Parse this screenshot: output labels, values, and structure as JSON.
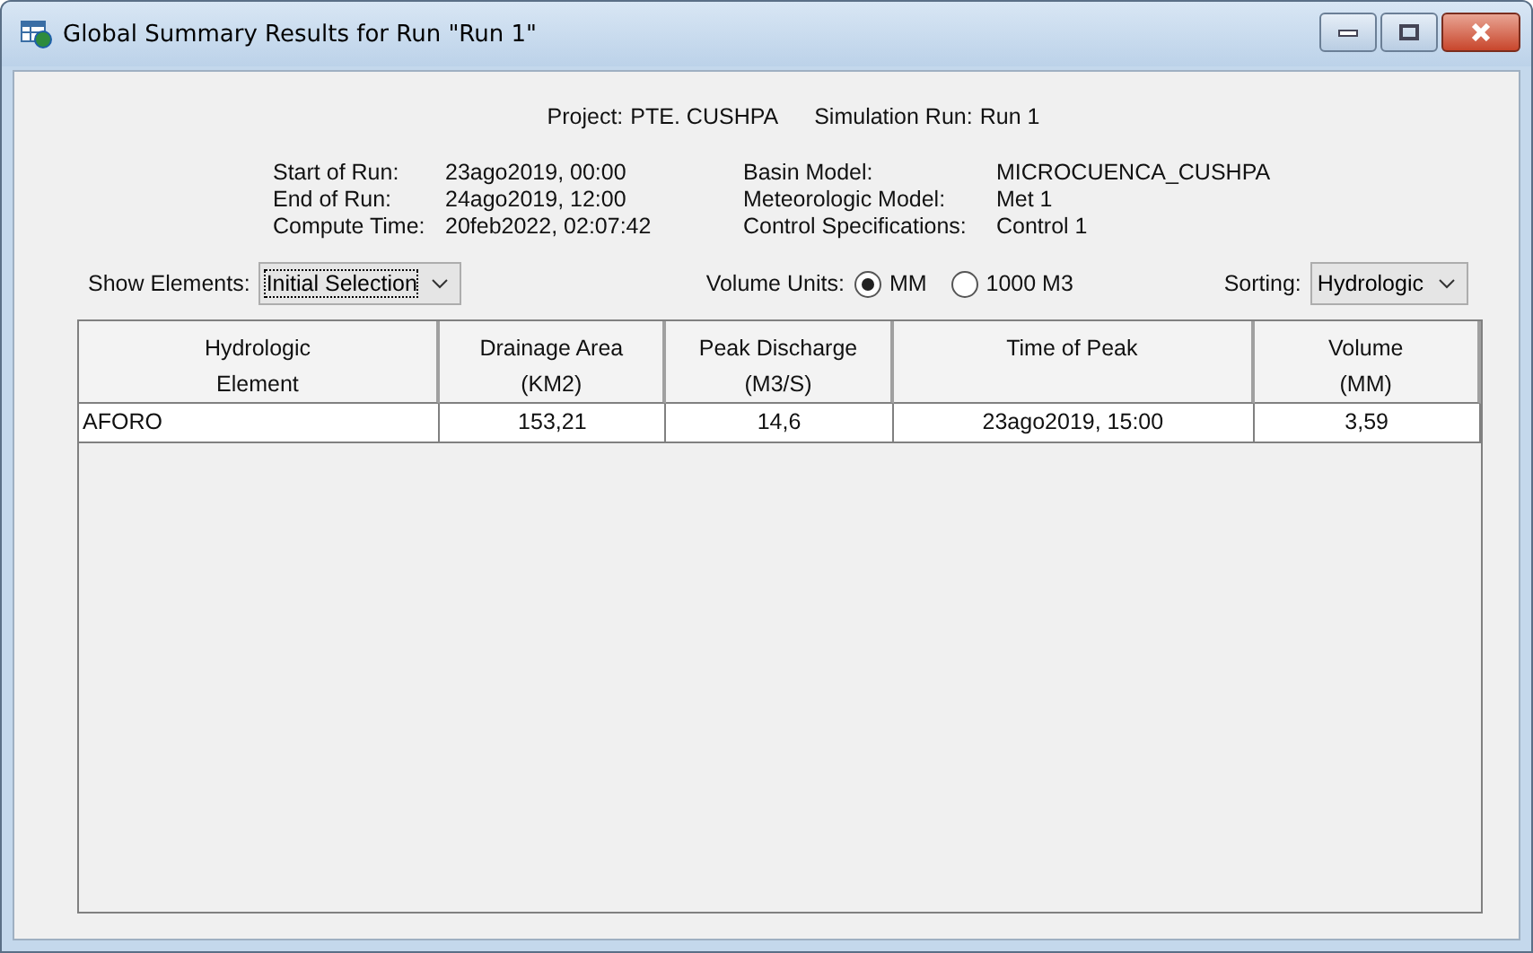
{
  "window": {
    "title": "Global Summary Results for Run \"Run 1\""
  },
  "header": [
    {
      "label": "Project:",
      "value": "PTE. CUSHPA"
    },
    {
      "label": "Simulation Run:",
      "value": "Run 1"
    }
  ],
  "run_info": [
    {
      "label": "Start of Run:",
      "value": "23ago2019, 00:00"
    },
    {
      "label": "Basin Model:",
      "value": "MICROCUENCA_CUSHPA"
    },
    {
      "label": "End of Run:",
      "value": "24ago2019, 12:00"
    },
    {
      "label": "Meteorologic Model:",
      "value": "Met 1"
    },
    {
      "label": "Compute Time:",
      "value": "20feb2022, 02:07:42"
    },
    {
      "label": "Control Specifications:",
      "value": "Control 1"
    }
  ],
  "show_elements": {
    "label": "Show Elements:",
    "value": "Initial Selection"
  },
  "volume_units": {
    "label": "Volume Units:",
    "options": [
      {
        "label": "MM",
        "selected": true
      },
      {
        "label": "1000 M3",
        "selected": false
      }
    ]
  },
  "sorting": {
    "label": "Sorting:",
    "value": "Hydrologic"
  },
  "table": {
    "columns": [
      "Hydrologic\nElement",
      "Drainage Area\n(KM2)",
      "Peak Discharge\n(M3/S)",
      "Time of Peak",
      "Volume\n(MM)"
    ],
    "rows": [
      [
        "AFORO",
        "153,21",
        "14,6",
        "23ago2019, 15:00",
        "3,59"
      ]
    ]
  }
}
